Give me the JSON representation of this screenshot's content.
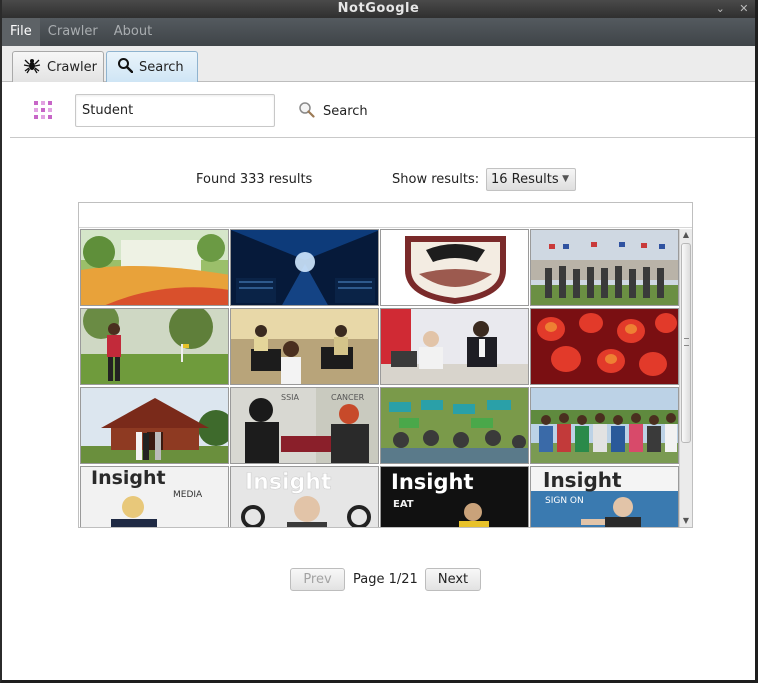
{
  "window": {
    "title": "NotGoogle",
    "controls": [
      "⌄",
      "✕"
    ]
  },
  "menu": {
    "items": [
      "File",
      "Crawler",
      "About"
    ],
    "active": "File"
  },
  "tabs": {
    "crawler_label": "Crawler",
    "search_label": "Search",
    "active": "Search"
  },
  "search": {
    "query": "Student",
    "button_label": "Search"
  },
  "results": {
    "found_text": "Found 333 results",
    "show_label": "Show results:",
    "per_page_selected": "16 Results"
  },
  "pagination": {
    "prev_label": "Prev",
    "page_label": "Page 1/21",
    "next_label": "Next"
  },
  "gallery": {
    "tiles": [
      {
        "name": "campus-lawn",
        "text": ""
      },
      {
        "name": "server-room-blue",
        "text": ""
      },
      {
        "name": "crest-shield",
        "text": ""
      },
      {
        "name": "group-with-flags",
        "text": ""
      },
      {
        "name": "woman-on-lawn",
        "text": ""
      },
      {
        "name": "students-at-computers",
        "text": ""
      },
      {
        "name": "men-with-laptop",
        "text": ""
      },
      {
        "name": "red-lanterns",
        "text": ""
      },
      {
        "name": "wooden-house",
        "text": ""
      },
      {
        "name": "two-women-magazine",
        "text": ""
      },
      {
        "name": "crowd-with-signs",
        "text": ""
      },
      {
        "name": "group-outdoors",
        "text": ""
      },
      {
        "name": "insight-media-cover",
        "text": "Insight",
        "subtext": "MEDIA"
      },
      {
        "name": "insight-headphones-cover",
        "text": "Insight",
        "subtext": ""
      },
      {
        "name": "insight-eat-cover",
        "text": "Insight",
        "subtext": "EAT"
      },
      {
        "name": "insight-signon-cover",
        "text": "Insight",
        "subtext": "SIGN ON"
      }
    ]
  }
}
